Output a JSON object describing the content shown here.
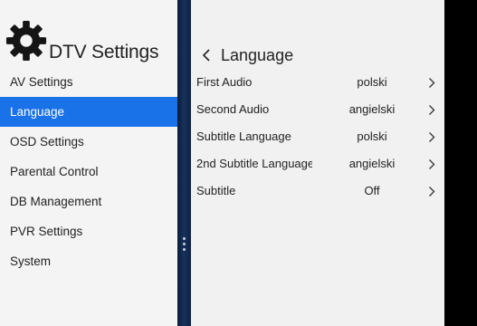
{
  "app": {
    "title": "DTV Settings",
    "icon": "gear-icon"
  },
  "sidebar": {
    "items": [
      {
        "label": "AV Settings",
        "selected": false
      },
      {
        "label": "Language",
        "selected": true
      },
      {
        "label": "OSD Settings",
        "selected": false
      },
      {
        "label": "Parental Control",
        "selected": false
      },
      {
        "label": "DB Management",
        "selected": false
      },
      {
        "label": "PVR Settings",
        "selected": false
      },
      {
        "label": "System",
        "selected": false
      }
    ]
  },
  "panel": {
    "title": "Language",
    "back_icon": "chevron-left-icon",
    "rows": [
      {
        "label": "First Audio",
        "value": "polski"
      },
      {
        "label": "Second Audio",
        "value": "angielski"
      },
      {
        "label": "Subtitle Language",
        "value": "polski"
      },
      {
        "label": "2nd Subtitle Language",
        "value": "angielski"
      },
      {
        "label": "Subtitle",
        "value": "Off"
      }
    ],
    "row_icon": "chevron-right-icon"
  },
  "colors": {
    "selected_bg": "#1a72e8",
    "divider": "#16315c",
    "panel_bg": "#f1f1f1"
  }
}
